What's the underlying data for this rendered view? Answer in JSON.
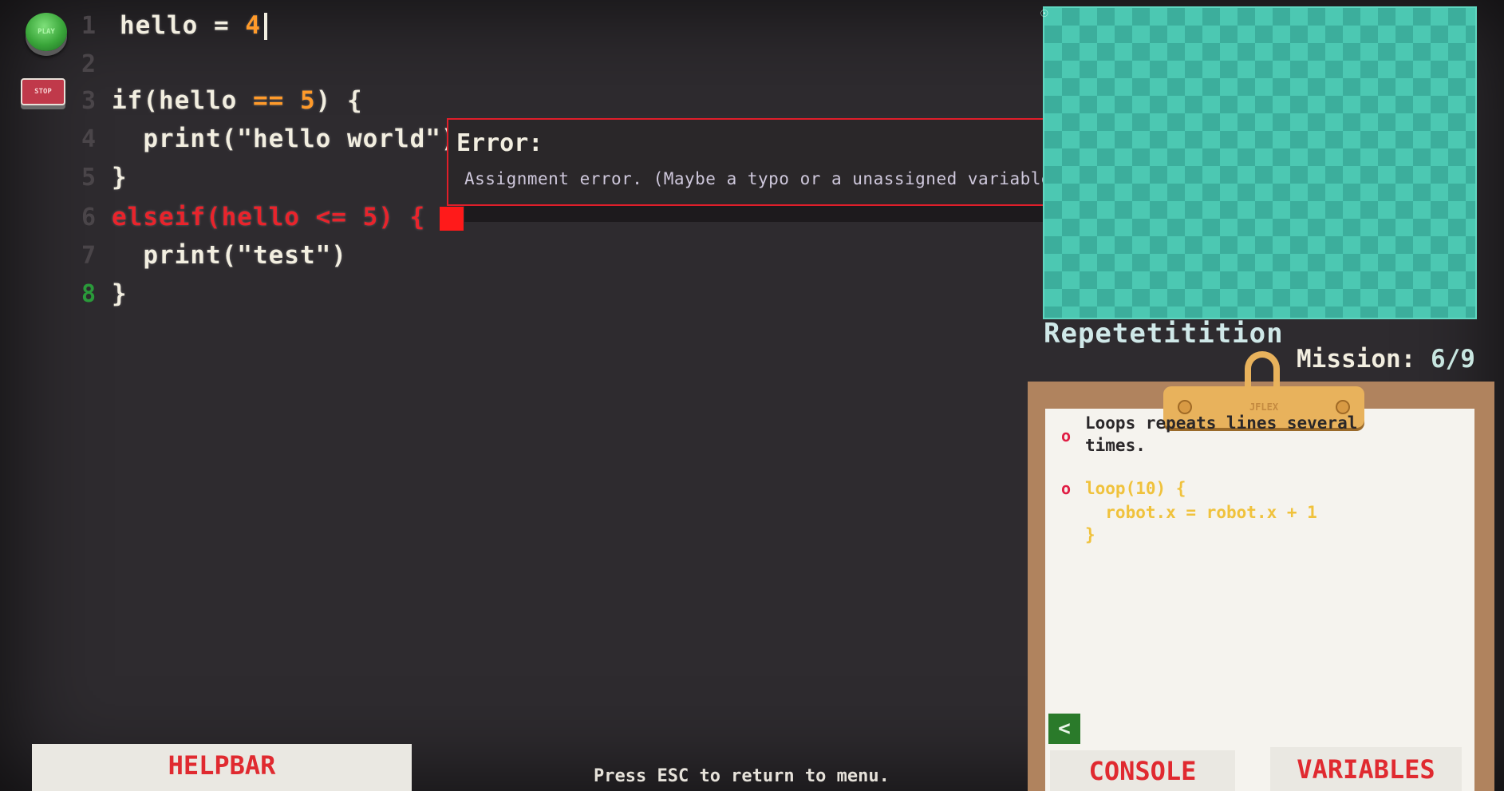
{
  "controls": {
    "play_label": "PLAY",
    "stop_label": "STOP"
  },
  "editor": {
    "lines": [
      {
        "n": "1",
        "code": "hello = ",
        "num": "4"
      },
      {
        "n": "2"
      },
      {
        "n": "3",
        "code": "if(hello ",
        "op": "== ",
        "num": "5",
        "tail": ") {"
      },
      {
        "n": "4",
        "code": "  print(\"hello world\")"
      },
      {
        "n": "5",
        "code": "}"
      },
      {
        "n": "6",
        "code": "elseif(hello <= 5) {"
      },
      {
        "n": "7",
        "code": "  print(\"test\")"
      },
      {
        "n": "8",
        "code": "}"
      }
    ]
  },
  "error": {
    "title": "Error:",
    "message": "Assignment error. (Maybe a typo or a unassigned variable?)"
  },
  "level": {
    "title": "Repetetitition",
    "mission_label": "Mission:",
    "mission_value": "6/9"
  },
  "clipboard": {
    "brand": "JFLEX",
    "text_line1": "Loops repeats lines several",
    "text_line2": "times.",
    "code_line1": "loop(10) {",
    "code_line2": "  robot.x = robot.x + 1",
    "code_line3": "}",
    "back_label": "<"
  },
  "tabs": {
    "console": "CONSOLE",
    "variables": "VARIABLES"
  },
  "helpbar": {
    "label": "HELPBAR"
  },
  "footer": {
    "hint": "Press ESC to return to menu."
  }
}
